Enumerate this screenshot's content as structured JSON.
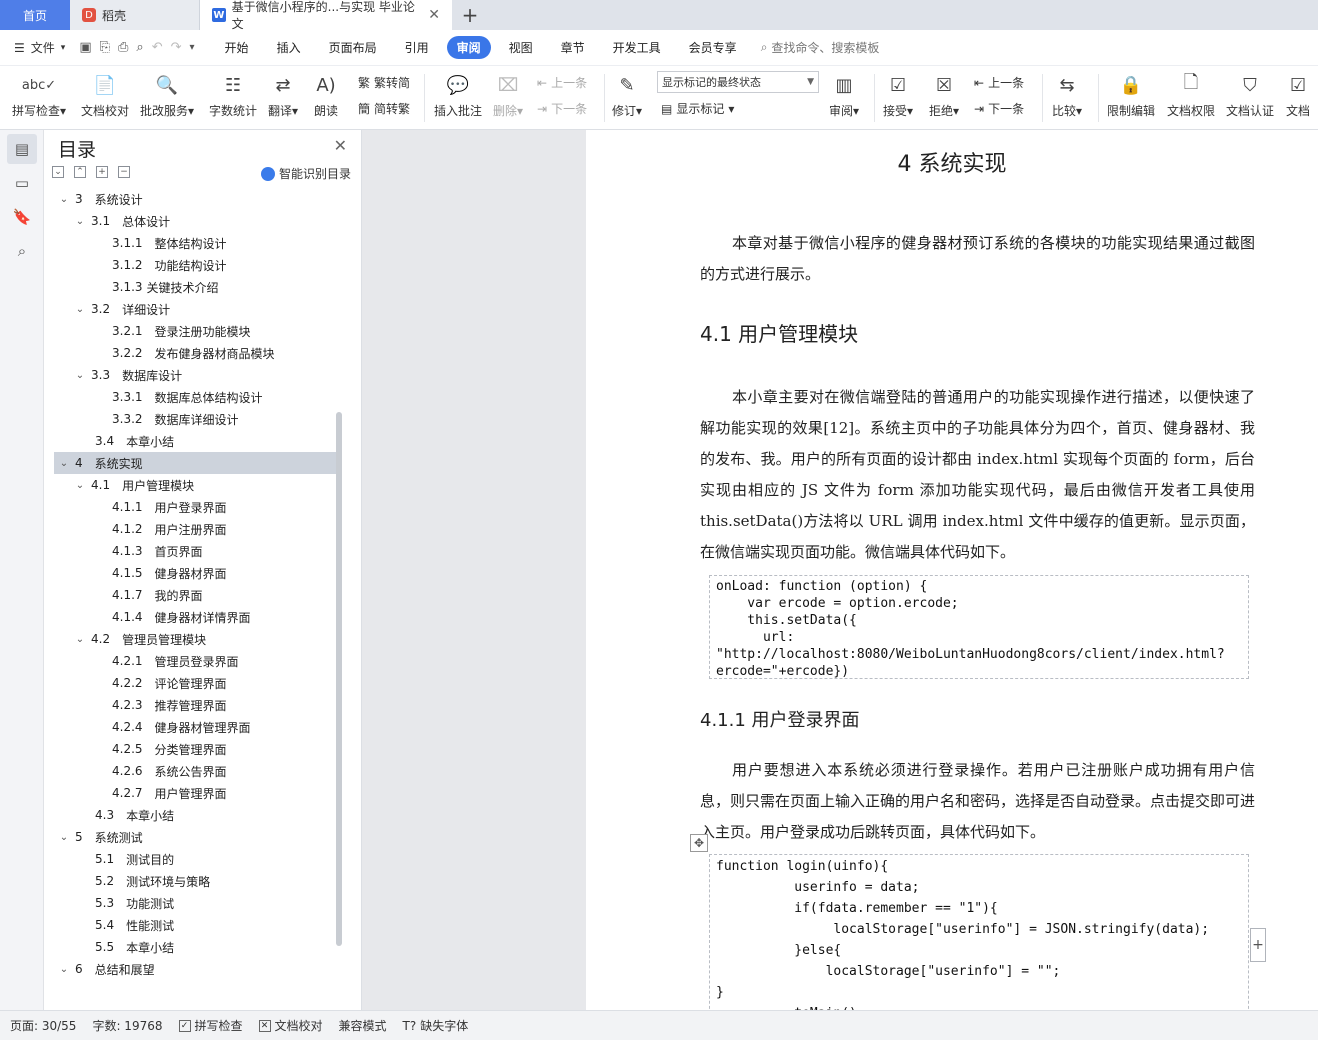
{
  "tabs": {
    "home": "首页",
    "daoke": "稻壳",
    "doc": "基于微信小程序的...与实现 毕业论文"
  },
  "menu": {
    "file": "文件",
    "items": [
      "开始",
      "插入",
      "页面布局",
      "引用",
      "审阅",
      "视图",
      "章节",
      "开发工具",
      "会员专享"
    ],
    "active": "审阅",
    "search": "查找命令、搜索模板"
  },
  "ribbon": {
    "spell": "拼写检查",
    "proof": "文档校对",
    "batch": "批改服务",
    "count": "字数统计",
    "translate": "翻译",
    "read": "朗读",
    "to_trad": "繁转简",
    "to_simp": "简转繁",
    "insert_comment": "插入批注",
    "delete": "删除",
    "prev": "上一条",
    "next": "下一条",
    "revise": "修订",
    "markup_select": "显示标记的最终状态",
    "show_markup": "显示标记",
    "review": "审阅",
    "accept": "接受",
    "reject": "拒绝",
    "prev2": "上一条",
    "next2": "下一条",
    "compare": "比较",
    "restrict": "限制编辑",
    "permission": "文档权限",
    "certify": "文档认证",
    "doc_cut": "文档"
  },
  "toc": {
    "title": "目录",
    "smart": "智能识别目录",
    "items": [
      {
        "num": "3",
        "text": "系统设计",
        "level": 1
      },
      {
        "num": "3.1",
        "text": "总体设计",
        "level": 2
      },
      {
        "num": "3.1.1",
        "text": "整体结构设计",
        "level": 3
      },
      {
        "num": "3.1.2",
        "text": "功能结构设计",
        "level": 3
      },
      {
        "num": "3.1.3",
        "text": "关键技术介绍",
        "level": 3
      },
      {
        "num": "3.2",
        "text": "详细设计",
        "level": 2
      },
      {
        "num": "3.2.1",
        "text": "登录注册功能模块",
        "level": 3
      },
      {
        "num": "3.2.2",
        "text": "发布健身器材商品模块",
        "level": 3
      },
      {
        "num": "3.3",
        "text": "数据库设计",
        "level": 2
      },
      {
        "num": "3.3.1",
        "text": "数据库总体结构设计",
        "level": 3
      },
      {
        "num": "3.3.2",
        "text": "数据库详细设计",
        "level": 3
      },
      {
        "num": "3.4",
        "text": "本章小结",
        "level": 2
      },
      {
        "num": "4",
        "text": "系统实现",
        "level": 1,
        "selected": true
      },
      {
        "num": "4.1",
        "text": "用户管理模块",
        "level": 2
      },
      {
        "num": "4.1.1",
        "text": "用户登录界面",
        "level": 3
      },
      {
        "num": "4.1.2",
        "text": "用户注册界面",
        "level": 3
      },
      {
        "num": "4.1.3",
        "text": "首页界面",
        "level": 3
      },
      {
        "num": "4.1.5",
        "text": "健身器材界面",
        "level": 3
      },
      {
        "num": "4.1.7",
        "text": "我的界面",
        "level": 3
      },
      {
        "num": "4.1.4",
        "text": "健身器材详情界面",
        "level": 3
      },
      {
        "num": "4.2",
        "text": "管理员管理模块",
        "level": 2
      },
      {
        "num": "4.2.1",
        "text": "管理员登录界面",
        "level": 3
      },
      {
        "num": "4.2.2",
        "text": "评论管理界面",
        "level": 3
      },
      {
        "num": "4.2.3",
        "text": "推荐管理界面",
        "level": 3
      },
      {
        "num": "4.2.4",
        "text": "健身器材管理界面",
        "level": 3
      },
      {
        "num": "4.2.5",
        "text": "分类管理界面",
        "level": 3
      },
      {
        "num": "4.2.6",
        "text": "系统公告界面",
        "level": 3
      },
      {
        "num": "4.2.7",
        "text": "用户管理界面",
        "level": 3
      },
      {
        "num": "4.3",
        "text": "本章小结",
        "level": 2
      },
      {
        "num": "5",
        "text": "系统测试",
        "level": 1
      },
      {
        "num": "5.1",
        "text": "测试目的",
        "level": 2
      },
      {
        "num": "5.2",
        "text": "测试环境与策略",
        "level": 2
      },
      {
        "num": "5.3",
        "text": "功能测试",
        "level": 2
      },
      {
        "num": "5.4",
        "text": "性能测试",
        "level": 2
      },
      {
        "num": "5.5",
        "text": "本章小结",
        "level": 2
      },
      {
        "num": "6",
        "text": "总结和展望",
        "level": 1
      }
    ]
  },
  "doc": {
    "chapter": "4  系统实现",
    "intro": "本章对基于微信小程序的健身器材预订系统的各模块的功能实现结果通过截图的方式进行展示。",
    "h41": "4.1   用户管理模块",
    "p41": "本小章主要对在微信端登陆的普通用户的功能实现操作进行描述，以便快速了解功能实现的效果[12]。系统主页中的子功能具体分为四个，首页、健身器材、我的发布、我。用户的所有页面的设计都由 index.html 实现每个页面的 form，后台实现由相应的 JS 文件为 form 添加功能实现代码，最后由微信开发者工具使用 this.setData()方法将以 URL 调用 index.html 文件中缓存的值更新。显示页面，在微信端实现页面功能。微信端具体代码如下。",
    "code1": "onLoad: function (option) {\n    var ercode = option.ercode;\n    this.setData({\n      url:\n\"http://localhost:8080/WeiboLuntanHuodong8cors/client/index.html?\nercode=\"+ercode})",
    "h411": "4.1.1   用户登录界面",
    "p411": "用户要想进入本系统必须进行登录操作。若用户已注册账户成功拥有用户信息，则只需在页面上输入正确的用户名和密码，选择是否自动登录。点击提交即可进入主页。用户登录成功后跳转页面，具体代码如下。",
    "code2": "function login(uinfo){\n          userinfo = data;\n          if(fdata.remember == \"1\"){\n               localStorage[\"userinfo\"] = JSON.stringify(data);\n          }else{\n              localStorage[\"userinfo\"] = \"\";\n}\n          toMain();"
  },
  "status": {
    "page": "页面: 30/55",
    "words": "字数: 19768",
    "spell": "拼写检查",
    "proof": "文档校对",
    "compat": "兼容模式",
    "missing_font": "缺失字体"
  }
}
